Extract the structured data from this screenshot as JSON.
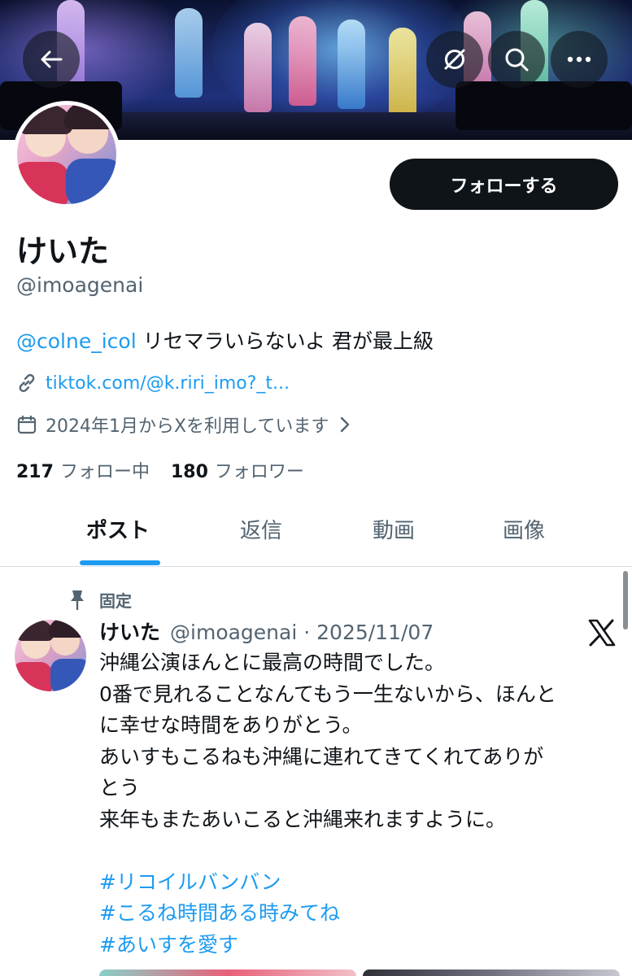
{
  "header": {
    "back_icon": "back-arrow-icon",
    "action_icons": [
      "grok-icon",
      "search-icon",
      "more-icon"
    ]
  },
  "profile": {
    "name": "けいた",
    "handle": "@imoagenai",
    "follow_label": "フォローする",
    "bio_mention": "@colne_icol",
    "bio_text": " リセマラいらないよ 君が最上級",
    "link": "tiktok.com/@k.riri_imo?_t...",
    "joined": "2024年1月からXを利用しています",
    "following_count": "217",
    "following_label": "フォロー中",
    "followers_count": "180",
    "followers_label": "フォロワー"
  },
  "tabs": [
    {
      "label": "ポスト",
      "active": true
    },
    {
      "label": "返信",
      "active": false
    },
    {
      "label": "動画",
      "active": false
    },
    {
      "label": "画像",
      "active": false
    }
  ],
  "post": {
    "pinned_label": "固定",
    "author_name": "けいた",
    "meta": "@imoagenai · 2025/11/07",
    "lines": [
      "沖縄公演ほんとに最高の時間でした。",
      "0番で見れることなんてもう一生ないから、ほんと",
      "に幸せな時間をありがとう。",
      "あいすもこるねも沖縄に連れてきてくれてありが",
      "とう",
      "来年もまたあいこると沖縄来れますように。"
    ],
    "hashtags": [
      "#リコイルバンバン",
      "#こるね時間ある時みてね",
      "#あいすを愛す"
    ]
  },
  "colors": {
    "accent": "#1d9bf0",
    "text": "#0f1419",
    "secondary": "#536471",
    "button_bg": "#0f1419"
  }
}
